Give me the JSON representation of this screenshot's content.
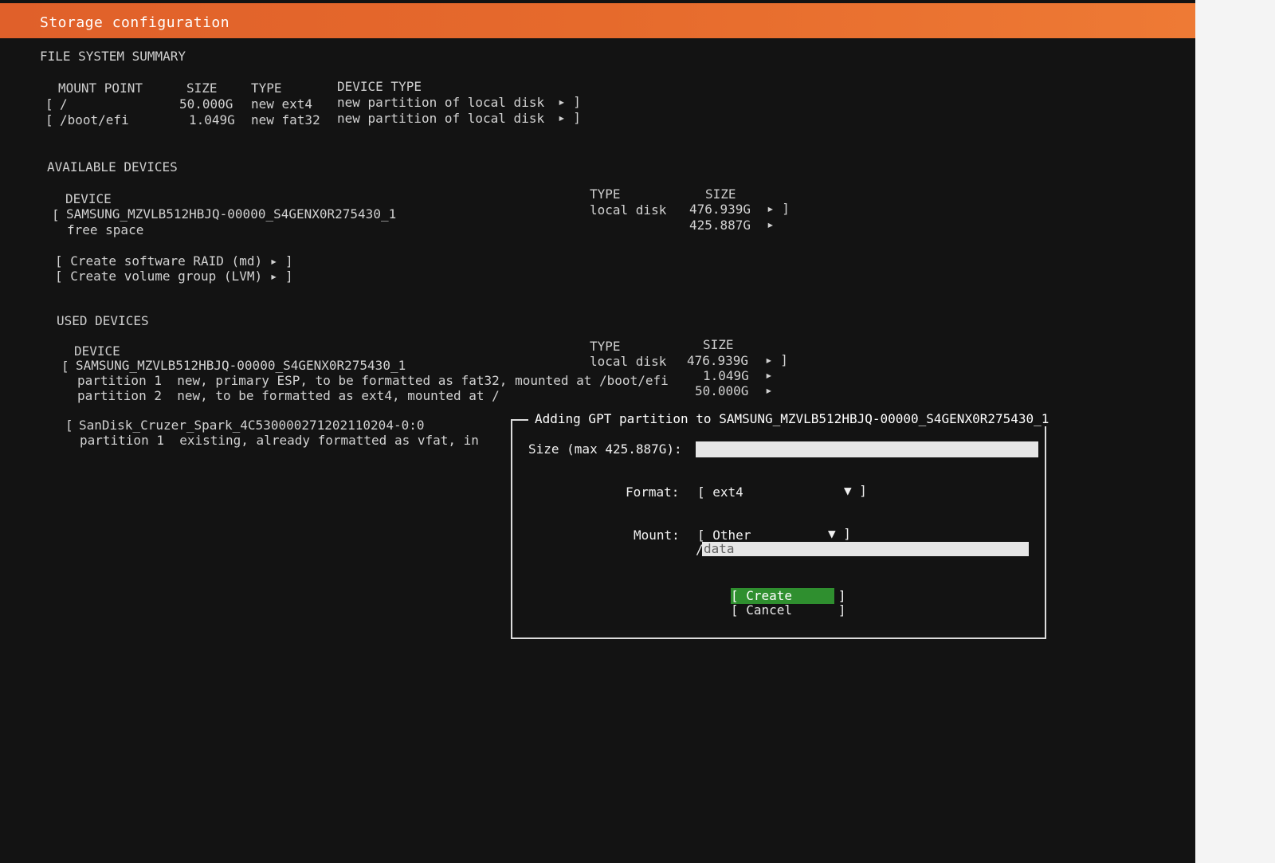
{
  "title": "Storage configuration",
  "fs_summary": {
    "heading": "FILE SYSTEM SUMMARY",
    "columns": [
      "MOUNT POINT",
      "SIZE",
      "TYPE",
      "DEVICE TYPE"
    ],
    "rows": [
      {
        "bracket": "[",
        "mount": "/",
        "size": "50.000G",
        "type": "new ext4",
        "device_type": "new partition of local disk",
        "arrow": "▸ ]"
      },
      {
        "bracket": "[",
        "mount": "/boot/efi",
        "size": "1.049G",
        "type": "new fat32",
        "device_type": "new partition of local disk",
        "arrow": "▸ ]"
      }
    ]
  },
  "available": {
    "heading": "AVAILABLE DEVICES",
    "col_device": "DEVICE",
    "col_type": "TYPE",
    "col_size": "SIZE",
    "disk": {
      "bracket": "[",
      "name": "SAMSUNG_MZVLB512HBJQ-00000_S4GENX0R275430_1",
      "type": "local disk",
      "size": "476.939G",
      "arrow": "▸ ]"
    },
    "free": {
      "name": "free space",
      "size": "425.887G",
      "arrow": "▸"
    },
    "actions": [
      "[ Create software RAID (md) ▸ ]",
      "[ Create volume group (LVM) ▸ ]"
    ]
  },
  "used": {
    "heading": "USED DEVICES",
    "col_device": "DEVICE",
    "col_type": "TYPE",
    "col_size": "SIZE",
    "disk": {
      "bracket": "[",
      "name": "SAMSUNG_MZVLB512HBJQ-00000_S4GENX0R275430_1",
      "type": "local disk",
      "size": "476.939G",
      "arrow": "▸ ]"
    },
    "partitions": [
      {
        "text": "partition 1  new, primary ESP, to be formatted as fat32, mounted at /boot/efi",
        "size": "1.049G",
        "arrow": "▸"
      },
      {
        "text": "partition 2  new, to be formatted as ext4, mounted at /",
        "size": "50.000G",
        "arrow": "▸"
      }
    ],
    "usb": {
      "bracket": "[",
      "name": "SanDisk_Cruzer_Spark_4C530000271202110204-0:0"
    },
    "usb_partition": "partition 1  existing, already formatted as vfat, in"
  },
  "dialog": {
    "title": "Adding GPT partition to SAMSUNG_MZVLB512HBJQ-00000_S4GENX0R275430_1",
    "size_label": "Size (max 425.887G):",
    "size_value": "",
    "format_label": "Format:",
    "format_value": "[ ext4",
    "format_arrow": "▼ ]",
    "mount_label": "Mount:",
    "mount_value": "[ Other",
    "mount_arrow": "▼ ]",
    "mount_path_prefix": "/",
    "mount_path": "data",
    "create_label": "[ Create      ]",
    "cancel_label": "[ Cancel      ]"
  }
}
